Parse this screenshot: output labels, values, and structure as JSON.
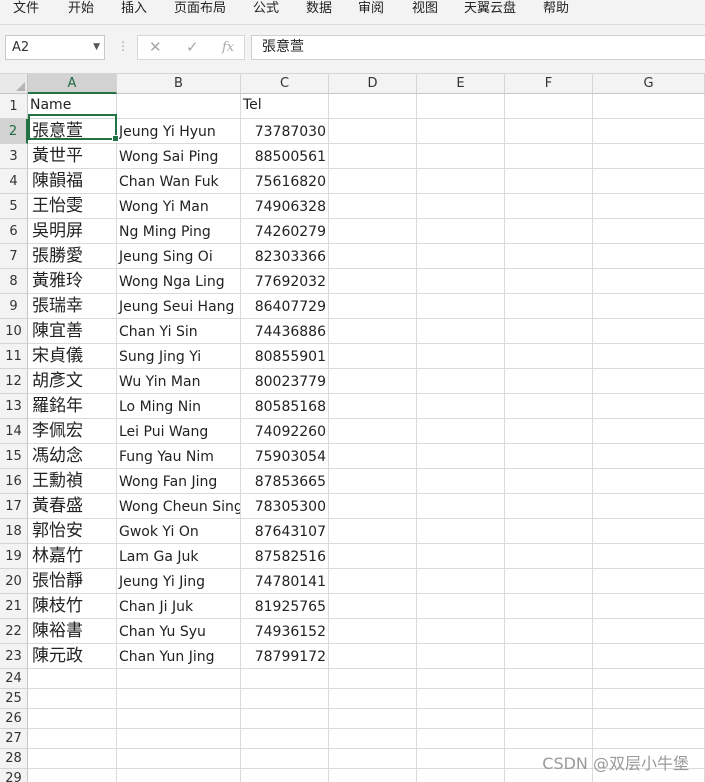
{
  "menu": [
    "文件",
    "开始",
    "插入",
    "页面布局",
    "公式",
    "数据",
    "审阅",
    "视图",
    "天翼云盘",
    "帮助"
  ],
  "formula_bar": {
    "name_box": "A2",
    "cancel_icon": "✕",
    "enter_icon": "✓",
    "function_icon": "fx",
    "content": "張意萱"
  },
  "columns": [
    "A",
    "B",
    "C",
    "D",
    "E",
    "F",
    "G"
  ],
  "selected_cell": "A2",
  "header_row": {
    "name": "Name",
    "roman": "",
    "tel": "Tel"
  },
  "rows": [
    {
      "name": "張意萱",
      "roman": "Jeung Yi Hyun",
      "tel": "73787030"
    },
    {
      "name": "黃世平",
      "roman": "Wong Sai Ping",
      "tel": "88500561"
    },
    {
      "name": "陳韻福",
      "roman": "Chan Wan Fuk",
      "tel": "75616820"
    },
    {
      "name": "王怡雯",
      "roman": "Wong Yi Man",
      "tel": "74906328"
    },
    {
      "name": "吳明屏",
      "roman": "Ng Ming Ping",
      "tel": "74260279"
    },
    {
      "name": "張勝愛",
      "roman": "Jeung Sing Oi",
      "tel": "82303366"
    },
    {
      "name": "黃雅玲",
      "roman": "Wong Nga Ling",
      "tel": "77692032"
    },
    {
      "name": "張瑞幸",
      "roman": "Jeung Seui Hang",
      "tel": "86407729"
    },
    {
      "name": "陳宜善",
      "roman": "Chan Yi Sin",
      "tel": "74436886"
    },
    {
      "name": "宋貞儀",
      "roman": "Sung Jing Yi",
      "tel": "80855901"
    },
    {
      "name": "胡彥文",
      "roman": "Wu Yin Man",
      "tel": "80023779"
    },
    {
      "name": "羅銘年",
      "roman": "Lo Ming Nin",
      "tel": "80585168"
    },
    {
      "name": "李佩宏",
      "roman": "Lei Pui Wang",
      "tel": "74092260"
    },
    {
      "name": "馮幼念",
      "roman": "Fung Yau Nim",
      "tel": "75903054"
    },
    {
      "name": "王勳禎",
      "roman": "Wong Fan Jing",
      "tel": "87853665"
    },
    {
      "name": "黃春盛",
      "roman": "Wong Cheun Sing",
      "tel": "78305300"
    },
    {
      "name": "郭怡安",
      "roman": "Gwok Yi On",
      "tel": "87643107"
    },
    {
      "name": "林嘉竹",
      "roman": "Lam Ga Juk",
      "tel": "87582516"
    },
    {
      "name": "張怡靜",
      "roman": "Jeung Yi Jing",
      "tel": "74780141"
    },
    {
      "name": "陳枝竹",
      "roman": "Chan Ji Juk",
      "tel": "81925765"
    },
    {
      "name": "陳裕書",
      "roman": "Chan Yu Syu",
      "tel": "74936152"
    },
    {
      "name": "陳元政",
      "roman": "Chan Yun Jing",
      "tel": "78799172"
    }
  ],
  "empty_row_numbers": [
    "24",
    "25",
    "26",
    "27",
    "28",
    "29"
  ],
  "watermark": "CSDN @双层小牛堡",
  "colors": {
    "accent": "#217346",
    "grid": "#dadada",
    "header_bg": "#f3f3f3",
    "header_selected_bg": "#d2d2d2"
  }
}
